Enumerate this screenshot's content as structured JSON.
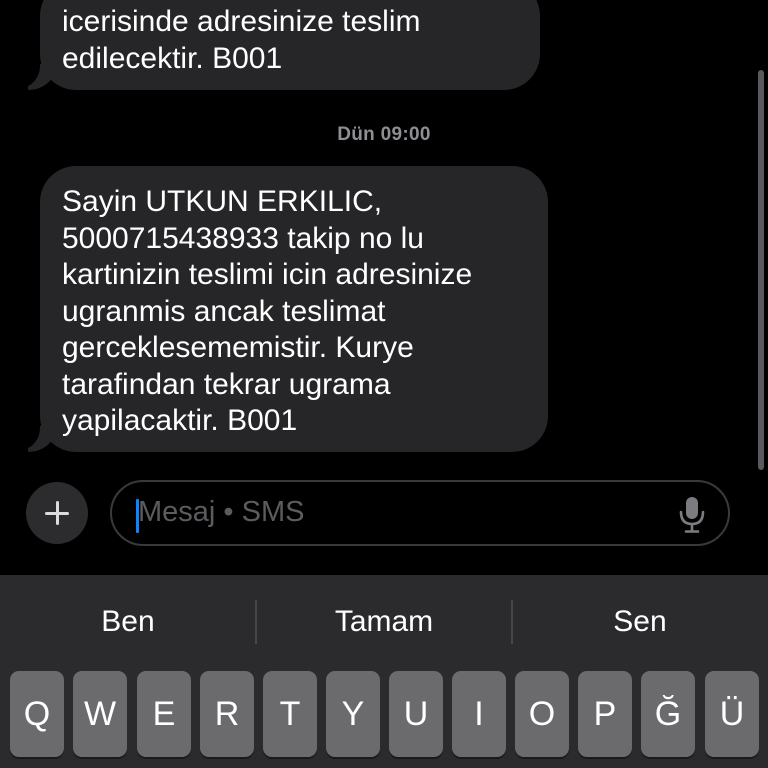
{
  "thread": {
    "messages": [
      {
        "lines": [
          "icerisinde adresinize teslim",
          "edilecektir. B001"
        ]
      },
      {
        "lines": [
          "Sayin UTKUN ERKILIC,",
          "5000715438933 takip no lu",
          "kartinizin teslimi icin adresinize",
          "ugranmis ancak teslimat",
          "gerceklesememistir. Kurye",
          "tarafindan tekrar ugrama",
          "yapilacaktir. B001"
        ]
      }
    ],
    "timestamp": "Dün 09:00"
  },
  "composer": {
    "placeholder": "Mesaj • SMS",
    "add_icon": "plus-icon",
    "mic_icon": "microphone-icon"
  },
  "keyboard": {
    "suggestions": [
      "Ben",
      "Tamam",
      "Sen"
    ],
    "keys": [
      "Q",
      "W",
      "E",
      "R",
      "T",
      "Y",
      "U",
      "I",
      "O",
      "P",
      "Ğ",
      "Ü"
    ]
  },
  "colors": {
    "bubble": "#262628",
    "caret": "#0a84ff",
    "keyboard_bg": "#2b2b2d",
    "key_bg": "#6b6b6e"
  }
}
